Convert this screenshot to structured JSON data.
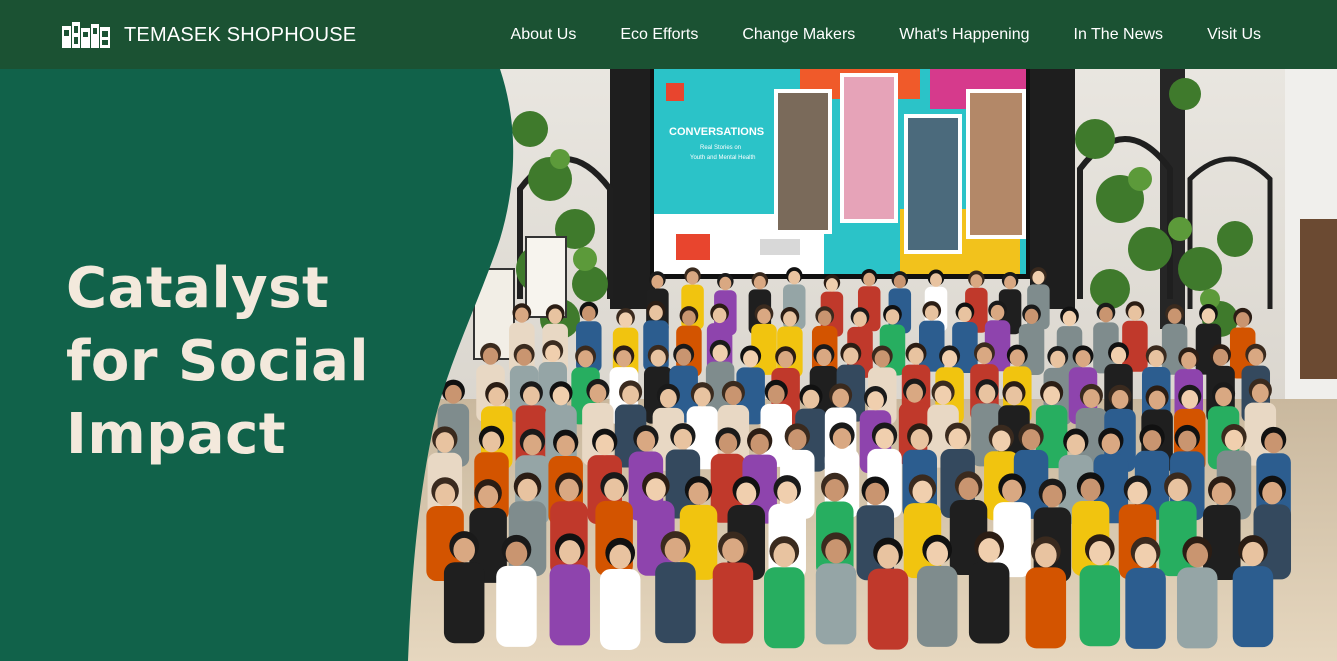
{
  "brand": {
    "name": "TEMASEK SHOPHOUSE",
    "logo_icon": "shophouse-logo-icon"
  },
  "nav": {
    "items": [
      {
        "label": "About Us"
      },
      {
        "label": "Eco Efforts"
      },
      {
        "label": "Change Makers"
      },
      {
        "label": "What's Happening"
      },
      {
        "label": "In The News"
      },
      {
        "label": "Visit Us"
      }
    ]
  },
  "hero": {
    "headline_lines": [
      "Catalyst",
      "for Social",
      "Impact"
    ],
    "photo": {
      "screen_title": "CONVERSATIONS",
      "screen_subtitle": "Real Stories on Youth and Mental Health"
    }
  },
  "colors": {
    "header_bg": "#1b5233",
    "panel_green": "#11624a",
    "headline_text": "#f3e9dc",
    "nav_text": "#ffffff",
    "screen_teal": "#2bc3c8",
    "screen_pink": "#d63a8c",
    "screen_yellow": "#f2c21c"
  }
}
